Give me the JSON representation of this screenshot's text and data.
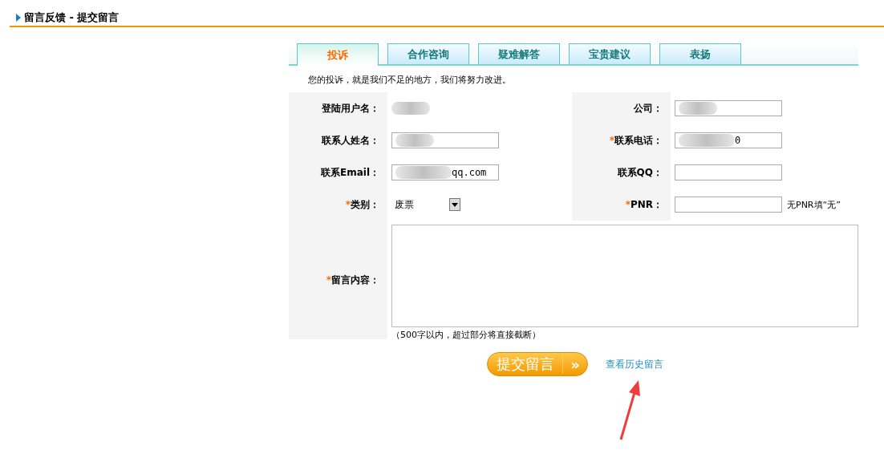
{
  "header": {
    "title": "留言反馈 - 提交留言"
  },
  "tabs": [
    {
      "label": "投诉",
      "selected": true
    },
    {
      "label": "合作咨询",
      "selected": false
    },
    {
      "label": "疑难解答",
      "selected": false
    },
    {
      "label": "宝贵建议",
      "selected": false
    },
    {
      "label": "表扬",
      "selected": false
    }
  ],
  "intro": "您的投诉，就是我们不足的地方，我们将努力改进。",
  "rows": [
    [
      {
        "label": "登陆用户名：",
        "required": false,
        "kind": "text",
        "redacted": true
      },
      {
        "label": "公司：",
        "required": false,
        "kind": "input",
        "redacted": true
      }
    ],
    [
      {
        "label": "联系人姓名：",
        "required": false,
        "kind": "input",
        "redacted": true
      },
      {
        "label": "联系电话：",
        "required": true,
        "kind": "input",
        "redacted": true,
        "value": "0"
      }
    ],
    [
      {
        "label": "联系Email：",
        "required": false,
        "kind": "input",
        "redacted": true,
        "value": "qq.com"
      },
      {
        "label": "联系QQ：",
        "required": false,
        "kind": "input",
        "redacted": false
      }
    ],
    [
      {
        "label": "类别：",
        "required": true,
        "kind": "select",
        "redacted": false,
        "value": "废票"
      },
      {
        "label": "PNR：",
        "required": true,
        "kind": "input",
        "redacted": false,
        "hint": "无PNR填“无”"
      }
    ]
  ],
  "message": {
    "label": "留言内容：",
    "required": true,
    "note": "（500字以内，超过部分将直接截断）"
  },
  "required_mark": "*",
  "submit": {
    "label": "提交留言",
    "arrow": "»"
  },
  "history_link": "查看历史留言"
}
